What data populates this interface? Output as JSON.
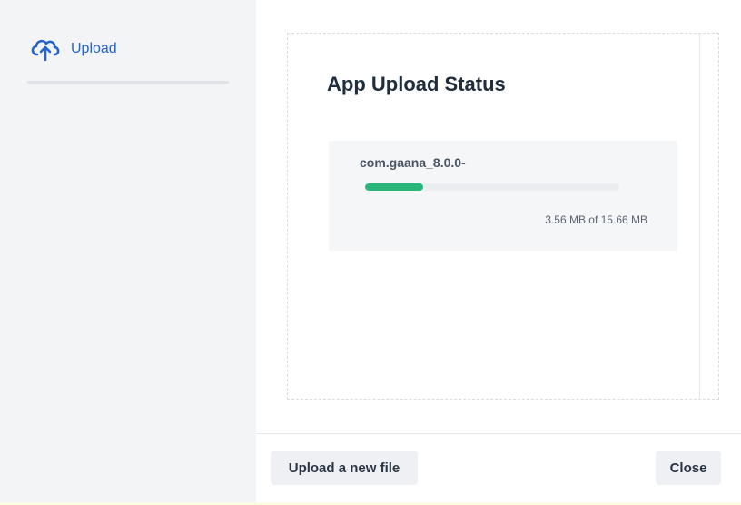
{
  "sidebar": {
    "items": [
      {
        "label": "Upload",
        "icon": "cloud-upload-icon"
      }
    ]
  },
  "main": {
    "title": "App Upload Status",
    "upload": {
      "file_name": "com.gaana_8.0.0-",
      "progress_fraction": 0.227,
      "size_text": "3.56 MB of 15.66 MB"
    }
  },
  "footer": {
    "upload_new_label": "Upload a new file",
    "close_label": "Close"
  },
  "colors": {
    "accent": "#2563c9",
    "progress": "#2bb57a"
  }
}
